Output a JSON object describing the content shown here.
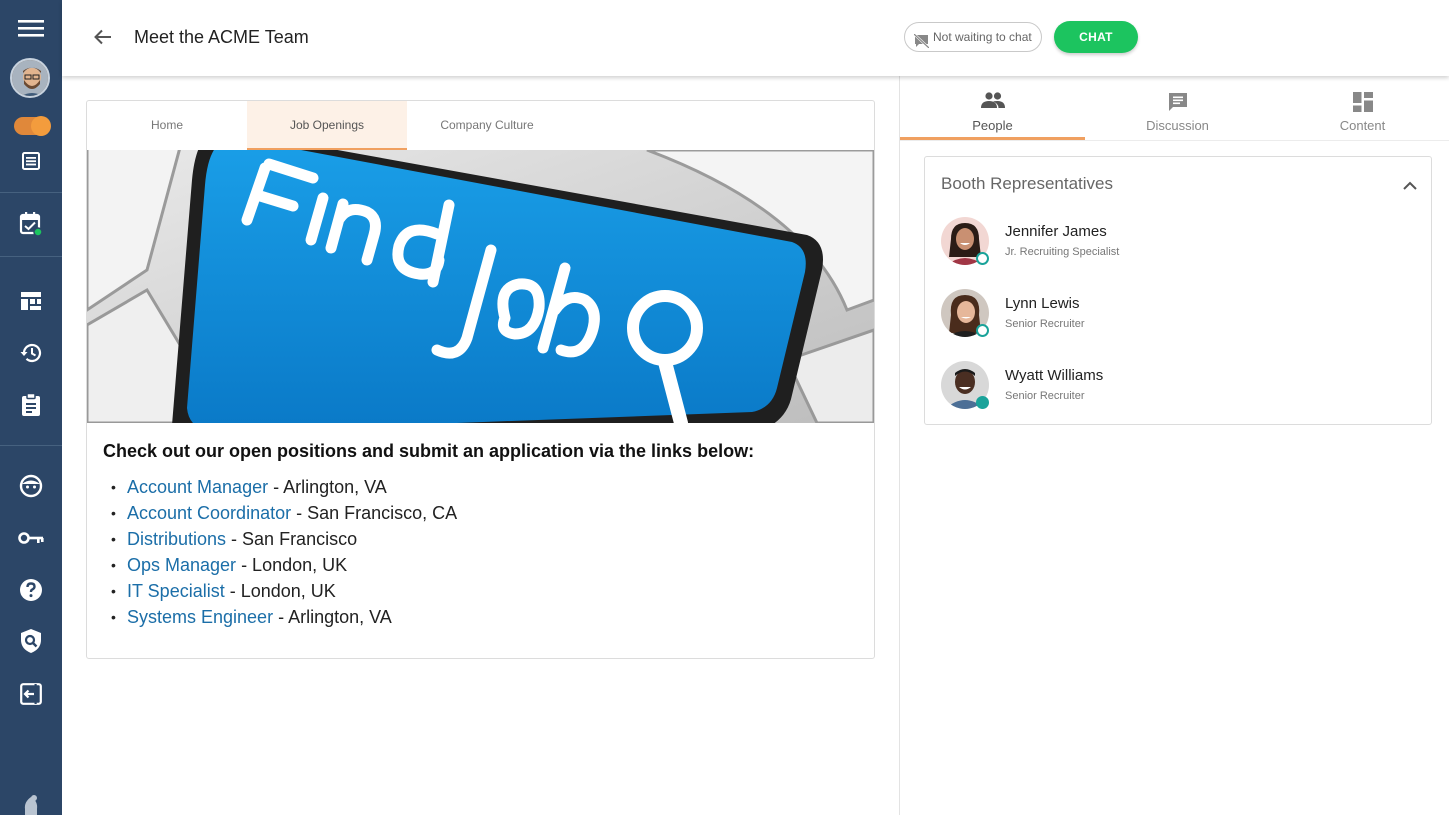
{
  "header": {
    "title": "Meet the ACME Team",
    "status_label": "Not waiting to chat",
    "chat_label": "CHAT"
  },
  "booth_tabs": [
    {
      "label": "Home"
    },
    {
      "label": "Job Openings"
    },
    {
      "label": "Company Culture"
    }
  ],
  "hero": {
    "key_text": "Find job"
  },
  "content": {
    "intro": "Check out our open positions and submit an application via the links below:",
    "jobs": [
      {
        "title": "Account Manager",
        "location": " - Arlington, VA"
      },
      {
        "title": "Account Coordinator",
        "location": " - San Francisco, CA"
      },
      {
        "title": "Distributions",
        "location": " - San Francisco"
      },
      {
        "title": "Ops Manager",
        "location": " - London, UK"
      },
      {
        "title": "IT Specialist",
        "location": " - London, UK"
      },
      {
        "title": "Systems Engineer",
        "location": " - Arlington, VA"
      }
    ]
  },
  "side_tabs": [
    {
      "label": "People",
      "icon": "people-icon"
    },
    {
      "label": "Discussion",
      "icon": "discussion-icon"
    },
    {
      "label": "Content",
      "icon": "content-icon"
    }
  ],
  "representatives": {
    "title": "Booth Representatives",
    "people": [
      {
        "name": "Jennifer James",
        "role": "Jr. Recruiting Specialist"
      },
      {
        "name": "Lynn Lewis",
        "role": "Senior Recruiter"
      },
      {
        "name": "Wyatt Williams",
        "role": "Senior Recruiter"
      }
    ]
  },
  "colors": {
    "sidebar": "#2c4667",
    "accent": "#f0a060",
    "chat_green": "#1cc45f",
    "link": "#1b6ea8",
    "online": "#1aa39a"
  }
}
